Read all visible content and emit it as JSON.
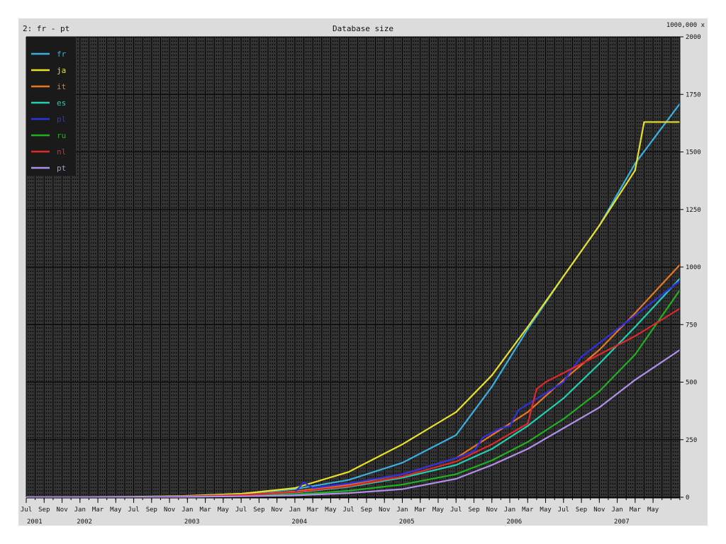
{
  "header": {
    "subtitle": "2: fr - pt",
    "scale_note": "1000,000 x"
  },
  "chart_data": {
    "type": "line",
    "title": "Database size",
    "xlabel": "",
    "ylabel": "",
    "ylim": [
      0,
      2000
    ],
    "y_ticks": [
      0,
      250,
      500,
      750,
      1000,
      1250,
      1500,
      1750,
      2000
    ],
    "x_range": [
      "2001-07",
      "2007-08"
    ],
    "x_tick_months": [
      "Jul",
      "Sep",
      "Nov",
      "Jan",
      "Mar",
      "May",
      "Jul",
      "Sep",
      "Nov",
      "Jan",
      "Mar",
      "May",
      "Jul",
      "Sep",
      "Nov",
      "Jan",
      "Mar",
      "May",
      "Jul",
      "Sep",
      "Nov",
      "Jan",
      "Mar",
      "May",
      "Jul",
      "Sep",
      "Nov",
      "Jan",
      "Mar",
      "May",
      "Jul",
      "Sep",
      "Nov",
      "Jan",
      "Mar",
      "May"
    ],
    "x_tick_years": [
      "2001",
      "2002",
      "2003",
      "2004",
      "2005",
      "2006",
      "2007"
    ],
    "grid": true,
    "legend_position": "top-left",
    "background": "#333333",
    "series": [
      {
        "name": "fr",
        "color": "#3ab0e0",
        "x": [
          "2001-07",
          "2002-07",
          "2003-01",
          "2003-07",
          "2004-01",
          "2004-07",
          "2005-01",
          "2005-07",
          "2005-11",
          "2006-03",
          "2006-07",
          "2006-11",
          "2007-03",
          "2007-08"
        ],
        "values": [
          0,
          2,
          6,
          15,
          35,
          75,
          150,
          270,
          480,
          730,
          960,
          1180,
          1450,
          1710
        ]
      },
      {
        "name": "ja",
        "color": "#e8e028",
        "x": [
          "2001-07",
          "2002-07",
          "2003-01",
          "2003-07",
          "2004-01",
          "2004-07",
          "2005-01",
          "2005-07",
          "2005-11",
          "2006-03",
          "2006-07",
          "2006-11",
          "2007-03",
          "2007-04",
          "2007-08"
        ],
        "values": [
          0,
          2,
          6,
          15,
          40,
          110,
          230,
          370,
          530,
          740,
          960,
          1180,
          1420,
          1630,
          1630
        ]
      },
      {
        "name": "it",
        "color": "#e87820",
        "x": [
          "2001-07",
          "2002-07",
          "2003-01",
          "2003-07",
          "2004-01",
          "2004-07",
          "2005-01",
          "2005-07",
          "2005-11",
          "2006-03",
          "2006-07",
          "2006-11",
          "2007-03",
          "2007-08"
        ],
        "values": [
          0,
          1,
          4,
          10,
          25,
          55,
          100,
          170,
          270,
          370,
          510,
          640,
          800,
          1010
        ]
      },
      {
        "name": "es",
        "color": "#20d0b0",
        "x": [
          "2001-07",
          "2002-07",
          "2003-01",
          "2003-07",
          "2004-01",
          "2004-07",
          "2005-01",
          "2005-07",
          "2005-11",
          "2006-03",
          "2006-07",
          "2006-11",
          "2007-03",
          "2007-08"
        ],
        "values": [
          0,
          1,
          3,
          8,
          20,
          45,
          85,
          140,
          210,
          310,
          430,
          580,
          740,
          950
        ]
      },
      {
        "name": "pl",
        "color": "#3030e0",
        "x": [
          "2001-07",
          "2002-07",
          "2003-01",
          "2003-07",
          "2004-01",
          "2004-02",
          "2004-03",
          "2004-07",
          "2005-01",
          "2005-07",
          "2005-09",
          "2005-10",
          "2005-12",
          "2006-01",
          "2006-02",
          "2006-07",
          "2006-08",
          "2006-09",
          "2007-01",
          "2007-08"
        ],
        "values": [
          0,
          1,
          4,
          10,
          22,
          65,
          40,
          60,
          100,
          170,
          200,
          260,
          300,
          310,
          380,
          500,
          560,
          610,
          730,
          940
        ]
      },
      {
        "name": "ru",
        "color": "#20b020",
        "x": [
          "2001-07",
          "2002-07",
          "2003-01",
          "2003-07",
          "2004-01",
          "2004-07",
          "2005-01",
          "2005-07",
          "2005-11",
          "2006-03",
          "2006-07",
          "2006-11",
          "2007-03",
          "2007-08"
        ],
        "values": [
          0,
          1,
          2,
          5,
          12,
          28,
          55,
          100,
          160,
          240,
          340,
          460,
          620,
          900
        ]
      },
      {
        "name": "nl",
        "color": "#e02828",
        "x": [
          "2001-07",
          "2002-07",
          "2003-01",
          "2003-07",
          "2004-01",
          "2004-07",
          "2005-01",
          "2005-07",
          "2005-11",
          "2006-03",
          "2006-04",
          "2006-05",
          "2006-07",
          "2006-11",
          "2007-03",
          "2007-08"
        ],
        "values": [
          0,
          1,
          3,
          9,
          22,
          48,
          90,
          155,
          230,
          320,
          470,
          500,
          540,
          620,
          700,
          820
        ]
      },
      {
        "name": "pt",
        "color": "#b090e8",
        "x": [
          "2001-07",
          "2002-07",
          "2003-01",
          "2003-07",
          "2004-01",
          "2004-07",
          "2005-01",
          "2005-07",
          "2005-11",
          "2006-03",
          "2006-07",
          "2006-11",
          "2007-03",
          "2007-08"
        ],
        "values": [
          0,
          1,
          2,
          4,
          8,
          18,
          35,
          80,
          140,
          210,
          300,
          390,
          510,
          640
        ]
      }
    ]
  }
}
